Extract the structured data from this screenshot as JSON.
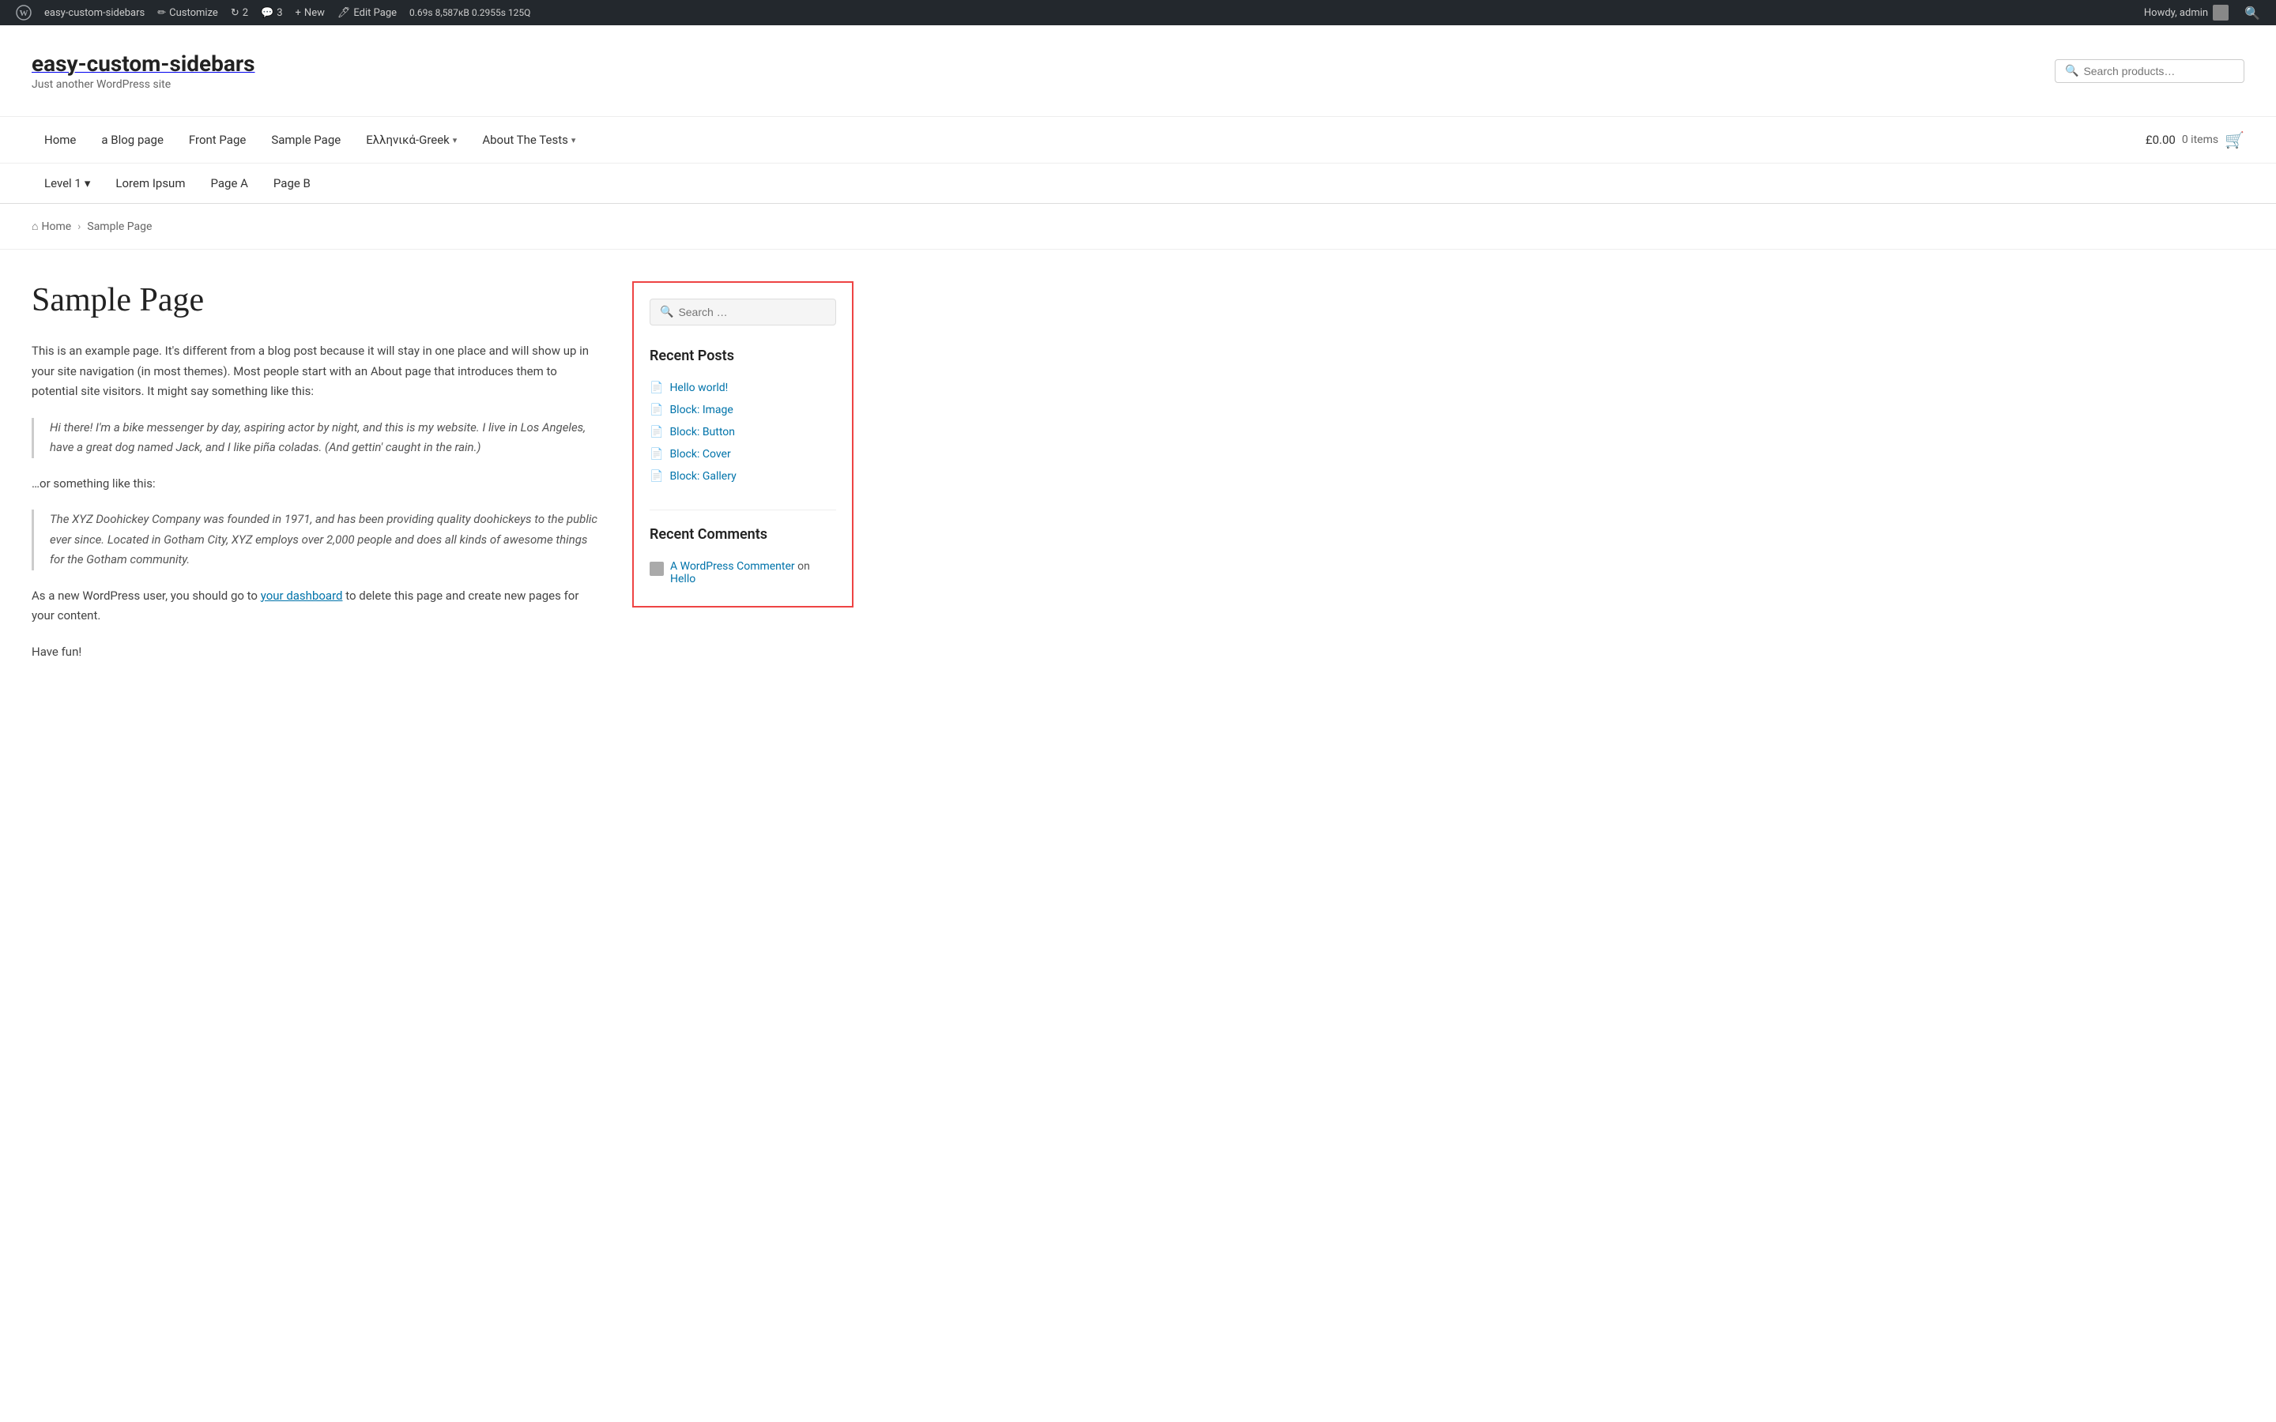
{
  "admin_bar": {
    "wp_logo_label": "WordPress",
    "site_name": "easy-custom-sidebars",
    "customize_label": "Customize",
    "updates_count": "2",
    "comments_count": "3",
    "new_label": "New",
    "edit_page_label": "Edit Page",
    "perf": "0.69s  8,587кB  0.2955s  125Q",
    "howdy": "Howdy, admin"
  },
  "header": {
    "site_title": "easy-custom-sidebars",
    "site_description": "Just another WordPress site",
    "search_placeholder": "Search products…"
  },
  "primary_nav": {
    "items": [
      {
        "label": "Home",
        "has_dropdown": false
      },
      {
        "label": "a Blog page",
        "has_dropdown": false
      },
      {
        "label": "Front Page",
        "has_dropdown": false
      },
      {
        "label": "Sample Page",
        "has_dropdown": false
      },
      {
        "label": "Ελληνικά-Greek",
        "has_dropdown": true
      },
      {
        "label": "About The Tests",
        "has_dropdown": true
      }
    ],
    "cart": {
      "amount": "£0.00",
      "items_label": "0 items"
    }
  },
  "secondary_nav": {
    "items": [
      {
        "label": "Level 1",
        "has_dropdown": true
      },
      {
        "label": "Lorem Ipsum",
        "has_dropdown": false
      },
      {
        "label": "Page A",
        "has_dropdown": false
      },
      {
        "label": "Page B",
        "has_dropdown": false
      }
    ]
  },
  "breadcrumb": {
    "home_label": "Home",
    "current": "Sample Page"
  },
  "main": {
    "page_title": "Sample Page",
    "paragraph1": "This is an example page. It's different from a blog post because it will stay in one place and will show up in your site navigation (in most themes). Most people start with an About page that introduces them to potential site visitors. It might say something like this:",
    "blockquote1": "Hi there! I'm a bike messenger by day, aspiring actor by night, and this is my website. I live in Los Angeles, have a great dog named Jack, and I like piña coladas. (And gettin' caught in the rain.)",
    "or_text": "…or something like this:",
    "blockquote2": "The XYZ Doohickey Company was founded in 1971, and has been providing quality doohickeys to the public ever since. Located in Gotham City, XYZ employs over 2,000 people and does all kinds of awesome things for the Gotham community.",
    "paragraph2_before": "As a new WordPress user, you should go to ",
    "dashboard_link": "your dashboard",
    "paragraph2_after": " to delete this page and create new pages for your content.",
    "paragraph3": "Have fun!"
  },
  "sidebar": {
    "search_placeholder": "Search …",
    "search_label": "Search",
    "recent_posts_title": "Recent Posts",
    "recent_posts": [
      {
        "label": "Hello world!"
      },
      {
        "label": "Block: Image"
      },
      {
        "label": "Block: Button"
      },
      {
        "label": "Block: Cover"
      },
      {
        "label": "Block: Gallery"
      }
    ],
    "recent_comments_title": "Recent Comments",
    "recent_comments": [
      {
        "author": "A WordPress Commenter",
        "on_text": "on",
        "post": "Hello"
      }
    ]
  }
}
